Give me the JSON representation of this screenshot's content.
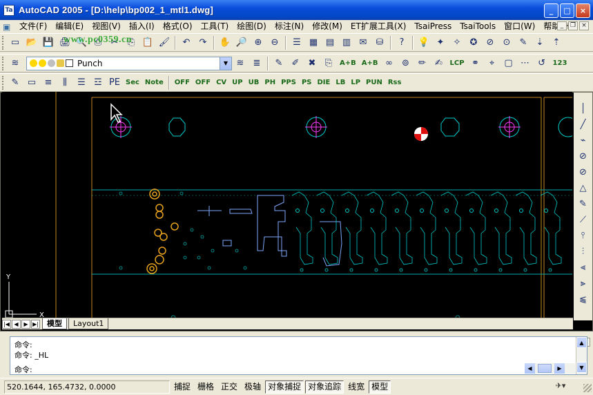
{
  "window": {
    "title": "AutoCAD 2005 - [D:\\help\\bp002_1_mtl1.dwg]",
    "app_icon_text": "Ta",
    "buttons": {
      "minimize": "_",
      "maximize": "□",
      "close": "×"
    }
  },
  "watermark": "www.pc0359.cn",
  "menubar": {
    "items": [
      "文件(F)",
      "编辑(E)",
      "视图(V)",
      "插入(I)",
      "格式(O)",
      "工具(T)",
      "绘图(D)",
      "标注(N)",
      "修改(M)",
      "ET扩展工具(X)",
      "TsaiPress",
      "TsaiTools",
      "窗口(W)",
      "帮助(H)"
    ]
  },
  "toolbar_icons": {
    "row1": [
      "new-icon",
      "open-icon",
      "save-icon",
      "print-icon",
      "preview-icon",
      "publish-icon",
      "cut-icon",
      "copy-icon",
      "paste-icon",
      "match-icon",
      "undo-icon",
      "redo-icon",
      "pan-icon",
      "zoom-realtime-icon",
      "zoom-window-icon",
      "zoom-previous-icon",
      "properties-icon",
      "designcenter-icon",
      "toolpalette-icon",
      "sheetset-icon",
      "markup-icon",
      "dbconnect-icon",
      "help-icon",
      "bulb-icon",
      "tsai-icon-1",
      "tsai-icon-2",
      "tsai-icon-3",
      "tsai-off-icon",
      "tsai-on-icon",
      "tsai-icon-4",
      "tsai-icon-5",
      "tsai-icon-6"
    ],
    "row1_glyphs": [
      "▭",
      "📂",
      "💾",
      "🖨",
      "🔍",
      "⎙",
      "✂",
      "⎘",
      "📋",
      "🖌",
      "↶",
      "↷",
      "✋",
      "🔎",
      "⊕",
      "⊖",
      "☰",
      "▦",
      "▤",
      "▥",
      "✉",
      "⛁",
      "?",
      "💡",
      "✦",
      "✧",
      "✪",
      "⊘",
      "⊙",
      "✎",
      "⇣",
      "⇡"
    ]
  },
  "layer_bar": {
    "current_layer": "Punch",
    "layer_colors": [
      "#ffd700",
      "#ffd700",
      "#c0c0c0",
      "#ffffff"
    ]
  },
  "toolbar3": {
    "labels": [
      "Sec",
      "Note",
      "OFF",
      "OFF",
      "CV",
      "UP",
      "UB",
      "PH",
      "PPS",
      "PS",
      "DIE",
      "LB",
      "LP",
      "PUN",
      "Rss"
    ]
  },
  "right_tools": [
    "│",
    "╱",
    "⌁",
    "⊘",
    "⊘",
    "△",
    "✎",
    "⟋",
    "⫯",
    "⫶",
    "⫷",
    "⫸",
    "⫹"
  ],
  "tabs": {
    "model": "模型",
    "layout1": "Layout1"
  },
  "command": {
    "lines": [
      "命令:",
      "命令: _HL",
      "命令:"
    ]
  },
  "status": {
    "coords": "520.1644, 165.4732, 0.0000",
    "buttons": [
      {
        "label": "捕捉",
        "on": false
      },
      {
        "label": "栅格",
        "on": false
      },
      {
        "label": "正交",
        "on": false
      },
      {
        "label": "极轴",
        "on": false
      },
      {
        "label": "对象捕捉",
        "on": true
      },
      {
        "label": "对象追踪",
        "on": true
      },
      {
        "label": "线宽",
        "on": false
      },
      {
        "label": "模型",
        "on": true
      }
    ]
  },
  "ucs": {
    "x_label": "X",
    "y_label": "Y"
  },
  "colors": {
    "canvas_bg": "#000000",
    "orange_line": "#c88a1e",
    "cyan_line": "#00cccc",
    "magenta": "#ff3cff",
    "red_marker": "#e01010",
    "yellow_holes": "#e8a31c",
    "blue_part": "#7fa8ff"
  }
}
